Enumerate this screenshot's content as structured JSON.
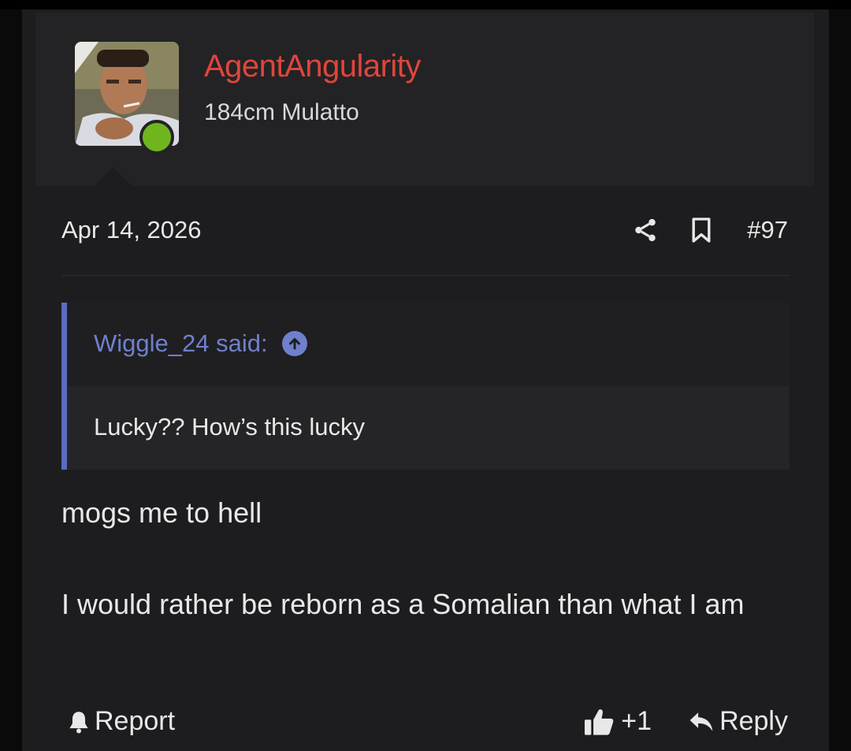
{
  "post": {
    "author": {
      "name": "AgentAngularity",
      "title": "184cm Mulatto",
      "online": true,
      "name_color": "#e0453c"
    },
    "date": "Apr 14, 2026",
    "number": "#97",
    "quote": {
      "author_line": "Wiggle_24 said:",
      "text": "Lucky?? How’s this lucky",
      "accent_color": "#5c6bc0"
    },
    "body": [
      "mogs me to hell",
      "I would rather be reborn as a Somalian than what I am"
    ],
    "footer": {
      "report_label": "Report",
      "like_count": "+1",
      "reply_label": "Reply"
    },
    "icons": [
      "share-icon",
      "bookmark-icon",
      "arrow-up-circle-icon",
      "bell-icon",
      "thumbs-up-icon",
      "reply-icon"
    ]
  }
}
